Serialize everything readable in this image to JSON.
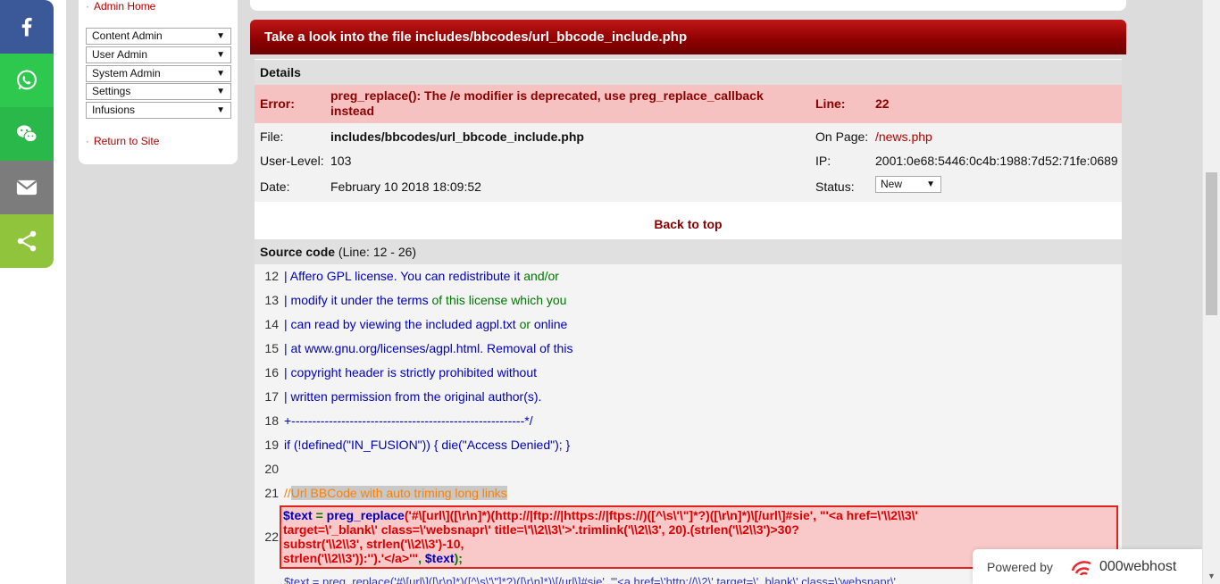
{
  "share": {
    "facebook_icon": "facebook-icon",
    "whatsapp_icon": "whatsapp-icon",
    "wechat_icon": "wechat-icon",
    "email_icon": "email-icon",
    "share_icon": "share-icon"
  },
  "sidebar": {
    "admin_home": "Admin Home",
    "selects": [
      "Content Admin",
      "User Admin",
      "System Admin",
      "Settings",
      "Infusions"
    ],
    "return_to_site": "Return to Site"
  },
  "banner": {
    "title": "Take a look into the file includes/bbcodes/url_bbcode_include.php"
  },
  "details": {
    "heading": "Details",
    "error_label": "Error:",
    "error_message": "preg_replace(): The /e modifier is deprecated, use preg_replace_callback instead",
    "line_label": "Line:",
    "line_value": "22",
    "file_label": "File:",
    "file_value": "includes/bbcodes/url_bbcode_include.php",
    "on_page_label": "On Page:",
    "on_page_value": "/news.php",
    "user_level_label": "User-Level:",
    "user_level_value": "103",
    "ip_label": "IP:",
    "ip_value": "2001:0e68:5446:0c4b:1988:7d52:71fe:0689",
    "date_label": "Date:",
    "date_value": "February 10 2018 18:09:52",
    "status_label": "Status:",
    "status_value": "New",
    "back_to_top": "Back to top"
  },
  "source": {
    "heading": "Source code",
    "range": "(Line: 12 - 26)",
    "lines": [
      {
        "num": "12",
        "text": "| Affero GPL license. You can redistribute it ",
        "tail": "and/or"
      },
      {
        "num": "13",
        "text": "| modify it under the terms ",
        "tail": "of this license which you"
      },
      {
        "num": "14",
        "text": "| can read by viewing the included agpl.txt ",
        "tail": "or",
        "tail2": " online"
      },
      {
        "num": "15",
        "text": "| at www.gnu.org/licenses/agpl.html. Removal of this",
        "tail": ""
      },
      {
        "num": "16",
        "text": "| copyright header is strictly prohibited without",
        "tail": ""
      },
      {
        "num": "17",
        "text": "| written permission from the original author(s).",
        "tail": ""
      },
      {
        "num": "18",
        "text": "+--------------------------------------------------------*/",
        "tail": ""
      },
      {
        "num": "19",
        "text": "if (!defined(\"IN_FUSION\")) { die(\"Access Denied\"); }",
        "tail": ""
      },
      {
        "num": "20",
        "text": "",
        "tail": ""
      },
      {
        "num": "21",
        "text": "//",
        "tail": "Url BBCode with auto triming long links"
      }
    ],
    "highlight_num": "22",
    "highlight": {
      "l1_var": "$text",
      "l1_op": " = ",
      "l1_fn": "preg_replace",
      "l1_str": "('#\\[url\\]([\\r\\n]*)(http://|ftp://|https://|ftps://)([^\\s\\'\\\"]*?)([\\r\\n]*)\\[/url\\]#sie', \"'<a href=\\'\\\\2\\\\3\\'",
      "l2": "   target=\\'_blank\\' class=\\'websnapr\\' title=\\'\\\\2\\\\3\\'>'.trimlink('\\\\2\\\\3', 20).(strlen('\\\\2\\\\3')>30?",
      "l3": "substr('\\\\2\\\\3', strlen('\\\\2\\\\3')-10,",
      "l4_str": "   strlen('\\\\2\\\\3')):'').'</a>'\"",
      "l4_sep": ", ",
      "l4_var": "$text",
      "l4_end": ");"
    },
    "tail_line": "$text = preg_replace('#\\[url\\]([\\r\\n]*)([^\\s\\'\\\"]*?)([\\r\\n]*)\\[/url\\]#sie', \"'<a href=\\'http://\\\\2\\' target=\\'_blank\\' class=\\'websnapr\\'"
  },
  "powered": {
    "label": "Powered by",
    "brand": "000webhost"
  }
}
